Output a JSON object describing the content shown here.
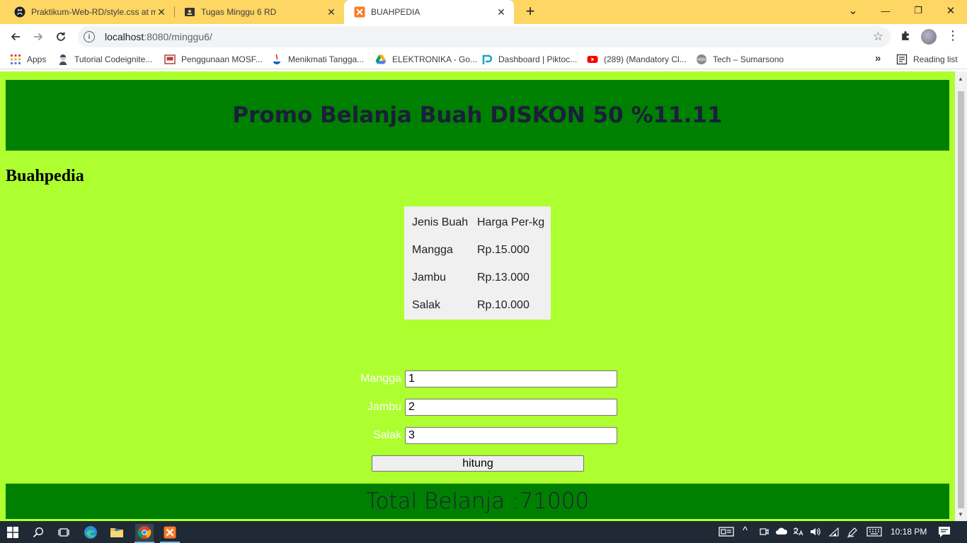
{
  "tabs": [
    {
      "title": "Praktikum-Web-RD/style.css at m",
      "close": "✕",
      "icon": "github-icon"
    },
    {
      "title": "Tugas Minggu 6 RD",
      "close": "✕",
      "icon": "classroom-icon"
    },
    {
      "title": "BUAHPEDIA",
      "close": "✕",
      "icon": "xampp-icon"
    }
  ],
  "newtab_symbol": "+",
  "window_controls": {
    "minimize": "—",
    "restore": "❐",
    "close": "✕",
    "tab_search": "⌄"
  },
  "address_bar": {
    "host": "localhost",
    "path": ":8080/minggu6/"
  },
  "bookmarks": [
    {
      "label": "Apps",
      "icon": "apps-grid-icon",
      "color": "#e8453c"
    },
    {
      "label": "Tutorial Codeignite...",
      "icon": "avatar-icon",
      "color": "#2f4d7a"
    },
    {
      "label": "Penggunaan MOSF...",
      "icon": "slides-icon",
      "color": "#b3413a"
    },
    {
      "label": "Menikmati Tangga...",
      "icon": "java-icon",
      "color": "#d03a2f"
    },
    {
      "label": "ELEKTRONIKA - Go...",
      "icon": "drive-icon",
      "color": "#34a853"
    },
    {
      "label": "Dashboard | Piktoc...",
      "icon": "piktochart-icon",
      "color": "#1aa3c7"
    },
    {
      "label": "(289) (Mandatory Cl...",
      "icon": "youtube-icon",
      "color": "#ff0000"
    },
    {
      "label": "Tech – Sumarsono",
      "icon": "globe-icon",
      "color": "#777777"
    }
  ],
  "reading_list": "Reading list",
  "more_bookmarks": "»",
  "page": {
    "banner": "Promo Belanja Buah DISKON 50 %11.11",
    "brand": "Buahpedia",
    "price_table": {
      "headers": [
        "Jenis Buah",
        "Harga Per-kg"
      ],
      "rows": [
        [
          "Mangga",
          "Rp.15.000"
        ],
        [
          "Jambu",
          "Rp.13.000"
        ],
        [
          "Salak",
          "Rp.10.000"
        ]
      ]
    },
    "form": {
      "fields": [
        {
          "label": "Mangga",
          "value": "1"
        },
        {
          "label": "Jambu",
          "value": "2"
        },
        {
          "label": "Salak",
          "value": "3"
        }
      ],
      "button": "hitung"
    },
    "total": "Total Belanja :71000"
  },
  "colors": {
    "page_bg": "#adff2f",
    "band_bg": "#008000",
    "band_text": "#1b1f3a",
    "tabstrip_bg": "#fdd663"
  },
  "taskbar": {
    "time": "10:18 PM"
  }
}
